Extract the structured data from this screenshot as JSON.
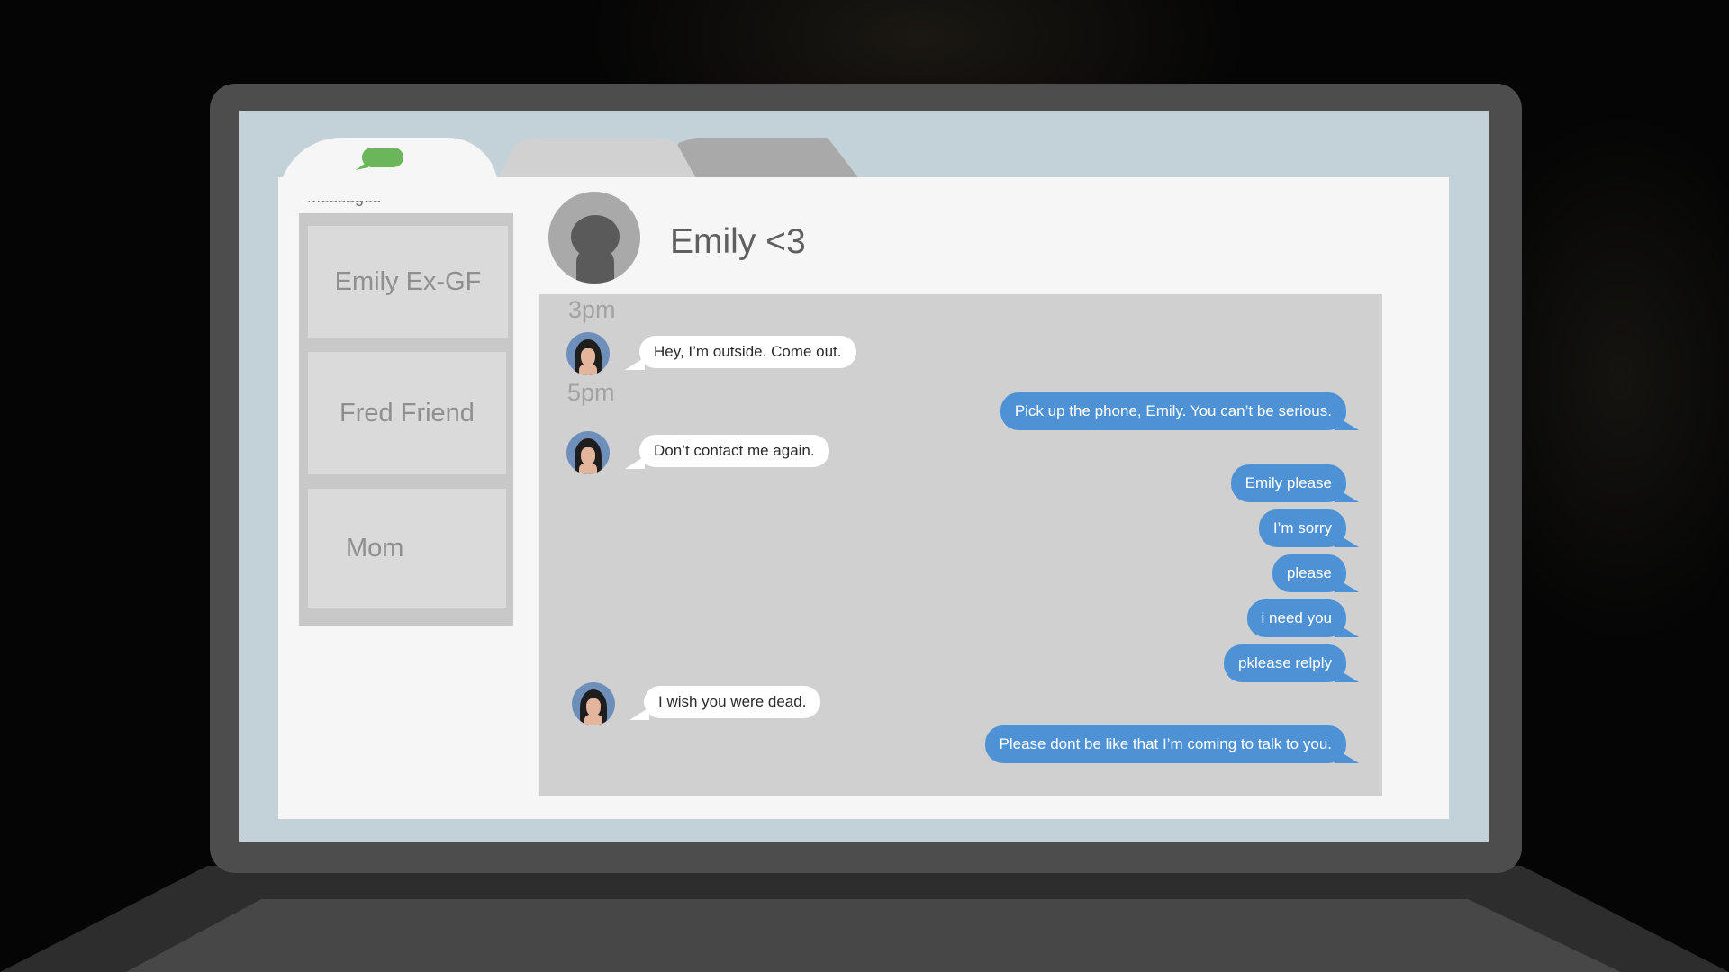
{
  "app": {
    "tabs": [
      {
        "icon": "message-bubble-icon",
        "label": "Messages",
        "active": true
      },
      {
        "active": false
      },
      {
        "active": false
      }
    ],
    "accent_color": "#6bb55b"
  },
  "sidebar": {
    "contacts": [
      {
        "name": "Emily Ex-GF"
      },
      {
        "name": "Fred Friend"
      },
      {
        "name": "Mom"
      }
    ]
  },
  "chat": {
    "title": "Emily <3",
    "outgoing_color": "#4e92d5",
    "messages": [
      {
        "type": "time",
        "text": "3pm"
      },
      {
        "type": "in",
        "text": "Hey, I’m outside. Come out."
      },
      {
        "type": "time",
        "text": "5pm"
      },
      {
        "type": "out",
        "text": "Pick up the phone, Emily. You can’t be serious."
      },
      {
        "type": "in",
        "text": "Don’t contact me again."
      },
      {
        "type": "out",
        "text": "Emily please"
      },
      {
        "type": "out",
        "text": "I’m sorry"
      },
      {
        "type": "out",
        "text": "please"
      },
      {
        "type": "out",
        "text": "i need you"
      },
      {
        "type": "out",
        "text": "pklease relply"
      },
      {
        "type": "in",
        "text": "I wish you were dead."
      },
      {
        "type": "out",
        "text": "Please dont be like that I’m coming to talk to you."
      }
    ]
  }
}
